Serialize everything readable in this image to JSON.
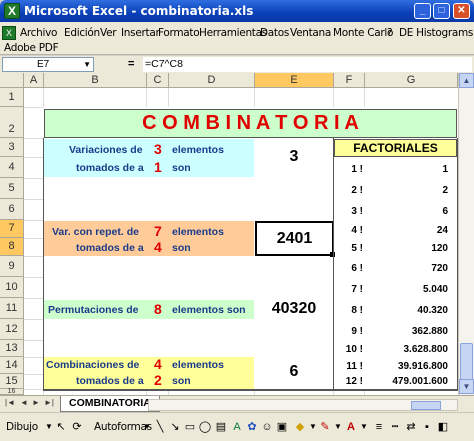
{
  "window": {
    "title": "Microsoft Excel - combinatoria.xls",
    "app_icon": "excel-icon"
  },
  "menu": {
    "items": [
      "Archivo",
      "Edición",
      "Ver",
      "Insertar",
      "Formato",
      "Herramientas",
      "Datos",
      "Ventana",
      "Monte Carlo",
      "?",
      "DE Histograms"
    ],
    "second_row": "Adobe PDF"
  },
  "formula_bar": {
    "name_box": "E7",
    "equals": "=",
    "formula": "=C7^C8"
  },
  "columns": [
    "A",
    "B",
    "C",
    "D",
    "E",
    "F",
    "G"
  ],
  "rows": [
    "1",
    "2",
    "3",
    "4",
    "5",
    "6",
    "7",
    "8",
    "9",
    "10",
    "11",
    "12",
    "13",
    "14",
    "15",
    "16"
  ],
  "selected": {
    "column": "E",
    "rows": [
      "7",
      "8"
    ]
  },
  "sheet": {
    "title": "C O M B I N A T O R I A",
    "variaciones": {
      "l1": "Variaciones de",
      "n": "3",
      "l1b": "elementos",
      "l2": "tomados de a",
      "k": "1",
      "l2b": "son",
      "result": "3",
      "color": "#ccffff"
    },
    "var_rep": {
      "l1": "Var. con repet. de",
      "n": "7",
      "l1b": "elementos",
      "l2": "tomados de a",
      "k": "4",
      "l2b": "son",
      "result": "2401",
      "color": "#ffcc99"
    },
    "permutaciones": {
      "l1": "Permutaciones de",
      "n": "8",
      "l1b": "elementos son",
      "result": "40320",
      "color": "#ccffcc"
    },
    "combinaciones": {
      "l1": "Combinaciones de",
      "n": "4",
      "l1b": "elementos",
      "l2": "tomados de a",
      "k": "2",
      "l2b": "son",
      "result": "6",
      "color": "#ffff99"
    },
    "factoriales": {
      "header": "FACTORIALES",
      "header_color": "#ffff99",
      "rows": [
        {
          "n": "1 !",
          "v": "1"
        },
        {
          "n": "2 !",
          "v": "2"
        },
        {
          "n": "3 !",
          "v": "6"
        },
        {
          "n": "4 !",
          "v": "24"
        },
        {
          "n": "5 !",
          "v": "120"
        },
        {
          "n": "6 !",
          "v": "720"
        },
        {
          "n": "7 !",
          "v": "5.040"
        },
        {
          "n": "8 !",
          "v": "40.320"
        },
        {
          "n": "9 !",
          "v": "362.880"
        },
        {
          "n": "10 !",
          "v": "3.628.800"
        },
        {
          "n": "11 !",
          "v": "39.916.800"
        },
        {
          "n": "12 !",
          "v": "479.001.600"
        }
      ]
    }
  },
  "tabs": {
    "nav": [
      "|◄",
      "◄",
      "►",
      "►|"
    ],
    "active": "COMBINATORIA"
  },
  "drawing": {
    "dibujo": "Dibujo",
    "autoformas": "Autoformas"
  }
}
